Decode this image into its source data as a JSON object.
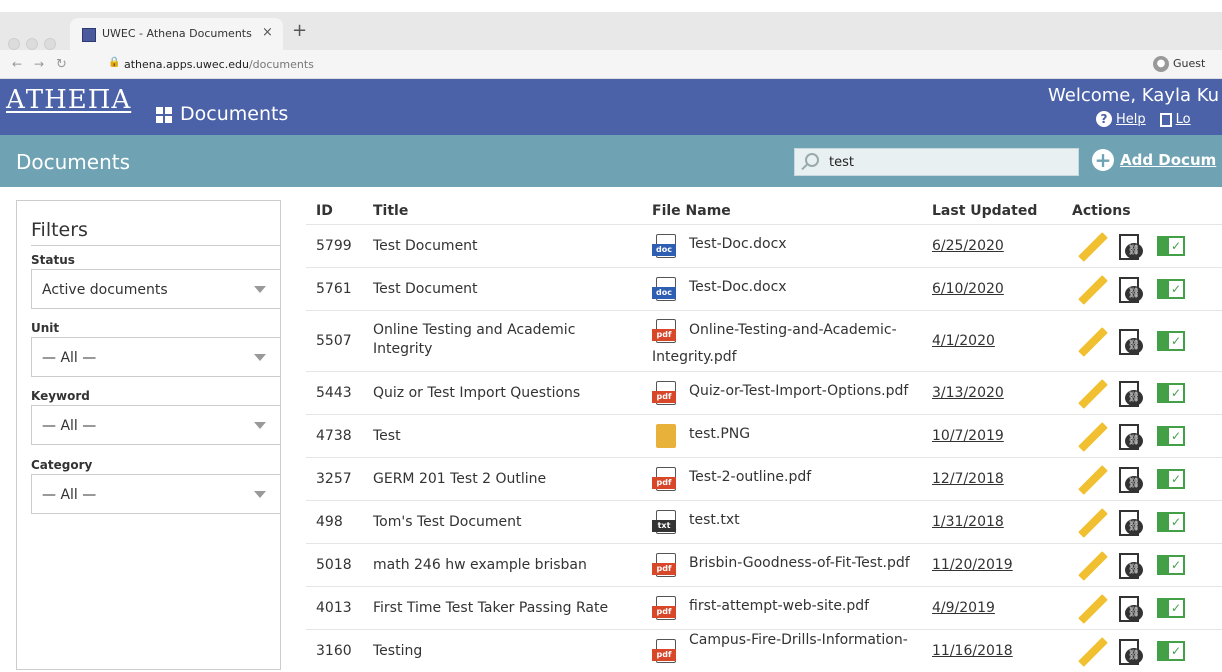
{
  "browser": {
    "tab_title": "UWEC - Athena Documents",
    "tab_close": "×",
    "new_tab": "+",
    "url_host": "athena.apps.uwec.edu",
    "url_path": "/documents",
    "guest_label": "Guest"
  },
  "header": {
    "logo": "ΑΤΗΕΠΑ",
    "app_name": "Documents",
    "welcome": "Welcome, Kayla Ku",
    "help": "Help",
    "logout": "Lo"
  },
  "titlebar": {
    "title": "Documents",
    "search_value": "test",
    "add_document": "Add Docum"
  },
  "filters": {
    "heading": "Filters",
    "status_label": "Status",
    "status_value": "Active documents",
    "unit_label": "Unit",
    "unit_value": "— All —",
    "keyword_label": "Keyword",
    "keyword_value": "— All —",
    "category_label": "Category",
    "category_value": "— All —"
  },
  "table": {
    "headers": {
      "id": "ID",
      "title": "Title",
      "file": "File Name",
      "updated": "Last Updated",
      "actions": "Actions"
    },
    "rows": [
      {
        "id": "5799",
        "title": "Test Document",
        "file": "Test-Doc.docx",
        "type": "doc",
        "updated": "6/25/2020"
      },
      {
        "id": "5761",
        "title": "Test Document",
        "file": "Test-Doc.docx",
        "type": "doc",
        "updated": "6/10/2020"
      },
      {
        "id": "5507",
        "title1": "Online Testing and Academic",
        "title2": "Integrity",
        "file1": "Online-Testing-and-Academic-",
        "file2": "Integrity.pdf",
        "type": "pdf",
        "updated": "4/1/2020"
      },
      {
        "id": "5443",
        "title": "Quiz or Test Import Questions",
        "file": "Quiz-or-Test-Import-Options.pdf",
        "type": "pdf",
        "updated": "3/13/2020"
      },
      {
        "id": "4738",
        "title": "Test",
        "file": "test.PNG",
        "type": "img",
        "updated": "10/7/2019"
      },
      {
        "id": "3257",
        "title": "GERM 201 Test 2 Outline",
        "file": "Test-2-outline.pdf",
        "type": "pdf",
        "updated": "12/7/2018"
      },
      {
        "id": "498",
        "title": "Tom's Test Document",
        "file": "test.txt",
        "type": "txt",
        "updated": "1/31/2018"
      },
      {
        "id": "5018",
        "title": "math 246 hw example brisban",
        "file": "Brisbin-Goodness-of-Fit-Test.pdf",
        "type": "pdf",
        "updated": "11/20/2019"
      },
      {
        "id": "4013",
        "title": "First Time Test Taker Passing Rate",
        "file": "first-attempt-web-site.pdf",
        "type": "pdf",
        "updated": "4/9/2019"
      },
      {
        "id": "3160",
        "title": "Testing",
        "file": "Campus-Fire-Drills-Information-",
        "type": "pdf",
        "updated": "11/16/2018"
      }
    ]
  },
  "icons": {
    "doc_tag": "doc",
    "pdf_tag": "pdf",
    "txt_tag": "txt",
    "check": "✓",
    "link_glyph": "⛓"
  },
  "colors": {
    "header": "#4b62a8",
    "titlebar": "#6fa3b4",
    "pdf": "#d9472b",
    "doc": "#2f5fb3",
    "img": "#e8b23a",
    "txt": "#333333",
    "check": "#43a047",
    "pencil": "#f0c030"
  }
}
